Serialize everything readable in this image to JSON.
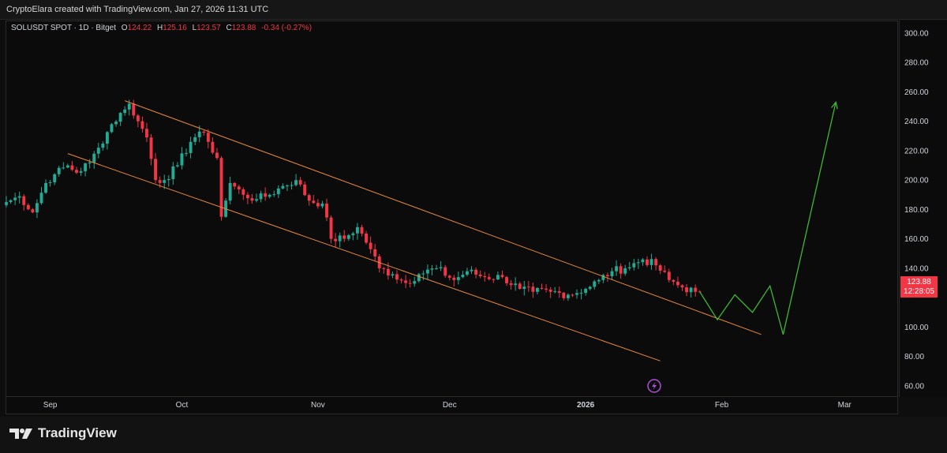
{
  "header": {
    "credit": "CryptoElara created with TradingView.com, Jan 27, 2026 11:31 UTC"
  },
  "legend": {
    "symbol": "SOLUSDT SPOT · 1D · Bitget",
    "o_label": "O",
    "o_value": "124.22",
    "h_label": "H",
    "h_value": "125.16",
    "l_label": "L",
    "l_value": "123.57",
    "c_label": "C",
    "c_value": "123.88",
    "change": "-0.34 (-0.27%)"
  },
  "price_badge": {
    "price": "123.88",
    "countdown": "12:28:05"
  },
  "footer": {
    "brand": "TradingView"
  },
  "colors": {
    "up": "#22ab94",
    "down": "#f23645",
    "channel": "#e8893a",
    "projection": "#3fb832",
    "background": "#0b0b0b",
    "axis_text": "#d1d4dc"
  },
  "icons": {
    "flash": "lightning-icon",
    "logo": "tradingview-logo-icon"
  },
  "chart_data": {
    "type": "candlestick",
    "symbol": "SOLUSDT SPOT",
    "interval": "1D",
    "exchange": "Bitget",
    "xlabel": "",
    "ylabel": "",
    "y_ticks": [
      "60.00",
      "80.00",
      "100.00",
      "120.00",
      "140.00",
      "160.00",
      "180.00",
      "200.00",
      "220.00",
      "240.00",
      "260.00",
      "280.00",
      "300.00"
    ],
    "ylim": [
      53,
      308
    ],
    "x_range": [
      "2025-08-22",
      "2026-03-13"
    ],
    "x_ticks": [
      {
        "date": "2025-09-01",
        "label": "Sep",
        "bold": false
      },
      {
        "date": "2025-10-01",
        "label": "Oct",
        "bold": false
      },
      {
        "date": "2025-11-01",
        "label": "Nov",
        "bold": false
      },
      {
        "date": "2025-12-01",
        "label": "Dec",
        "bold": false
      },
      {
        "date": "2026-01-01",
        "label": "2026",
        "bold": true
      },
      {
        "date": "2026-02-01",
        "label": "Feb",
        "bold": false
      },
      {
        "date": "2026-03-01",
        "label": "Mar",
        "bold": false
      }
    ],
    "anchors": [
      [
        "2025-08-22",
        185
      ],
      [
        "2025-08-25",
        189
      ],
      [
        "2025-08-28",
        178
      ],
      [
        "2025-08-31",
        198
      ],
      [
        "2025-09-02",
        204
      ],
      [
        "2025-09-05",
        210
      ],
      [
        "2025-09-07",
        205
      ],
      [
        "2025-09-10",
        212
      ],
      [
        "2025-09-12",
        222
      ],
      [
        "2025-09-15",
        238
      ],
      [
        "2025-09-18",
        248
      ],
      [
        "2025-09-19",
        252
      ],
      [
        "2025-09-21",
        240
      ],
      [
        "2025-09-23",
        229
      ],
      [
        "2025-09-25",
        200
      ],
      [
        "2025-09-27",
        200
      ],
      [
        "2025-09-30",
        210
      ],
      [
        "2025-10-03",
        226
      ],
      [
        "2025-10-05",
        233
      ],
      [
        "2025-10-07",
        226
      ],
      [
        "2025-10-09",
        215
      ],
      [
        "2025-10-10",
        175
      ],
      [
        "2025-10-12",
        198
      ],
      [
        "2025-10-15",
        190
      ],
      [
        "2025-10-18",
        187
      ],
      [
        "2025-10-21",
        190
      ],
      [
        "2025-10-24",
        196
      ],
      [
        "2025-10-27",
        200
      ],
      [
        "2025-10-30",
        186
      ],
      [
        "2025-11-02",
        184
      ],
      [
        "2025-11-04",
        160
      ],
      [
        "2025-11-07",
        160
      ],
      [
        "2025-11-10",
        168
      ],
      [
        "2025-11-13",
        153
      ],
      [
        "2025-11-15",
        140
      ],
      [
        "2025-11-18",
        136
      ],
      [
        "2025-11-21",
        130
      ],
      [
        "2025-11-24",
        136
      ],
      [
        "2025-11-28",
        140
      ],
      [
        "2025-12-02",
        132
      ],
      [
        "2025-12-05",
        138
      ],
      [
        "2025-12-09",
        134
      ],
      [
        "2025-12-13",
        134
      ],
      [
        "2025-12-17",
        126
      ],
      [
        "2025-12-20",
        124
      ],
      [
        "2025-12-24",
        124
      ],
      [
        "2025-12-28",
        122
      ],
      [
        "2026-01-01",
        126
      ],
      [
        "2026-01-04",
        132
      ],
      [
        "2026-01-07",
        138
      ],
      [
        "2026-01-10",
        140
      ],
      [
        "2026-01-14",
        146
      ],
      [
        "2026-01-17",
        142
      ],
      [
        "2026-01-20",
        132
      ],
      [
        "2026-01-23",
        127
      ],
      [
        "2026-01-26",
        124
      ],
      [
        "2026-01-27",
        123.88
      ]
    ],
    "last": {
      "date": "2026-01-27",
      "open": 124.22,
      "high": 125.16,
      "low": 123.57,
      "close": 123.88
    },
    "annotations": [
      {
        "name": "channel-upper-line",
        "points": [
          [
            "2025-09-18",
            254
          ],
          [
            "2026-02-10",
            95
          ]
        ]
      },
      {
        "name": "channel-lower-line",
        "points": [
          [
            "2025-09-05",
            218
          ],
          [
            "2026-01-18",
            77
          ]
        ]
      },
      {
        "name": "projection-path",
        "points": [
          [
            "2026-01-27",
            124
          ],
          [
            "2026-01-31",
            105
          ],
          [
            "2026-02-04",
            122
          ],
          [
            "2026-02-08",
            110
          ],
          [
            "2026-02-12",
            128
          ],
          [
            "2026-02-15",
            95
          ],
          [
            "2026-02-27",
            253
          ]
        ]
      }
    ]
  }
}
